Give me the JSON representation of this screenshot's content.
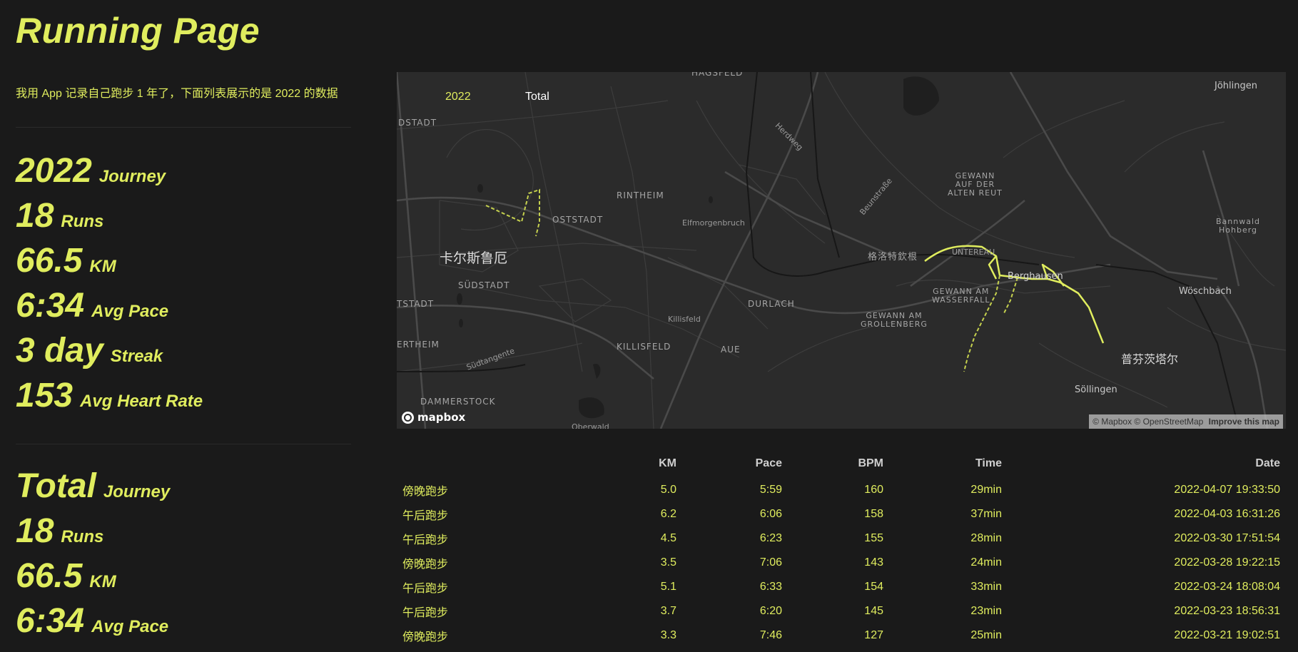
{
  "header": {
    "title": "Running Page"
  },
  "intro": "我用 App 记录自己跑步 1 年了，下面列表展示的是 2022 的数据",
  "year_stats": {
    "items": [
      {
        "value": "2022",
        "label": "Journey"
      },
      {
        "value": "18",
        "label": "Runs"
      },
      {
        "value": "66.5",
        "label": "KM"
      },
      {
        "value": "6:34",
        "label": "Avg Pace"
      },
      {
        "value": "3 day",
        "label": "Streak"
      },
      {
        "value": "153",
        "label": "Avg Heart Rate"
      }
    ]
  },
  "total_stats": {
    "items": [
      {
        "value": "Total",
        "label": "Journey"
      },
      {
        "value": "18",
        "label": "Runs"
      },
      {
        "value": "66.5",
        "label": "KM"
      },
      {
        "value": "6:34",
        "label": "Avg Pace"
      }
    ]
  },
  "map": {
    "tabs": [
      "2022",
      "Total"
    ],
    "labels": {
      "hagsfeld": "HAGSFELD",
      "dstadt": "DSTADT",
      "rintheim": "RINTHEIM",
      "oststadt": "OSTSTADT",
      "elfmorgenbruch": "Elfmorgenbruch",
      "karlsruhe": "卡尔斯鲁厄",
      "suedstadt": "SÜDSTADT",
      "tstadt": "TSTADT",
      "ertheim": "ERTHEIM",
      "killisfeld_small": "Killisfeld",
      "killisfeld": "KILLISFELD",
      "durlach": "DURLACH",
      "aue": "AUE",
      "dammerstock": "DAMMERSTOCK",
      "oberwald": "Oberwald",
      "suedtangente": "Südtangente",
      "herdweg": "Herdweg",
      "beunstrasse": "Beunstraße",
      "grotzingen": "格洛特欽根",
      "untereau": "UNTEREAU",
      "berghausen": "Berghausen",
      "gewann_alten_reut": "GEWANN\nAUF DER\nALTEN REUT",
      "gewann_wasserfall": "GEWANN AM\nWASSERFALL",
      "gewann_grollenberg": "GEWANN AM\nGROLLENBERG",
      "pfinztal": "普芬茨塔尔",
      "soellingen": "Söllingen",
      "woeschbach": "Wöschbach",
      "bannwald": "Bannwald\nHohberg",
      "joehlingen": "Jöhlingen"
    },
    "logo": "mapbox",
    "attribution": "© Mapbox © OpenStreetMap",
    "improve": "Improve this map",
    "route_color": "#e0ed5e"
  },
  "runs_table": {
    "headers": [
      "",
      "KM",
      "Pace",
      "BPM",
      "Time",
      "Date"
    ],
    "rows": [
      {
        "name": "傍晚跑步",
        "km": "5.0",
        "pace": "5:59",
        "bpm": "160",
        "time": "29min",
        "date": "2022-04-07 19:33:50"
      },
      {
        "name": "午后跑步",
        "km": "6.2",
        "pace": "6:06",
        "bpm": "158",
        "time": "37min",
        "date": "2022-04-03 16:31:26"
      },
      {
        "name": "午后跑步",
        "km": "4.5",
        "pace": "6:23",
        "bpm": "155",
        "time": "28min",
        "date": "2022-03-30 17:51:54"
      },
      {
        "name": "傍晚跑步",
        "km": "3.5",
        "pace": "7:06",
        "bpm": "143",
        "time": "24min",
        "date": "2022-03-28 19:22:15"
      },
      {
        "name": "午后跑步",
        "km": "5.1",
        "pace": "6:33",
        "bpm": "154",
        "time": "33min",
        "date": "2022-03-24 18:08:04"
      },
      {
        "name": "午后跑步",
        "km": "3.7",
        "pace": "6:20",
        "bpm": "145",
        "time": "23min",
        "date": "2022-03-23 18:56:31"
      },
      {
        "name": "傍晚跑步",
        "km": "3.3",
        "pace": "7:46",
        "bpm": "127",
        "time": "25min",
        "date": "2022-03-21 19:02:51"
      }
    ]
  }
}
